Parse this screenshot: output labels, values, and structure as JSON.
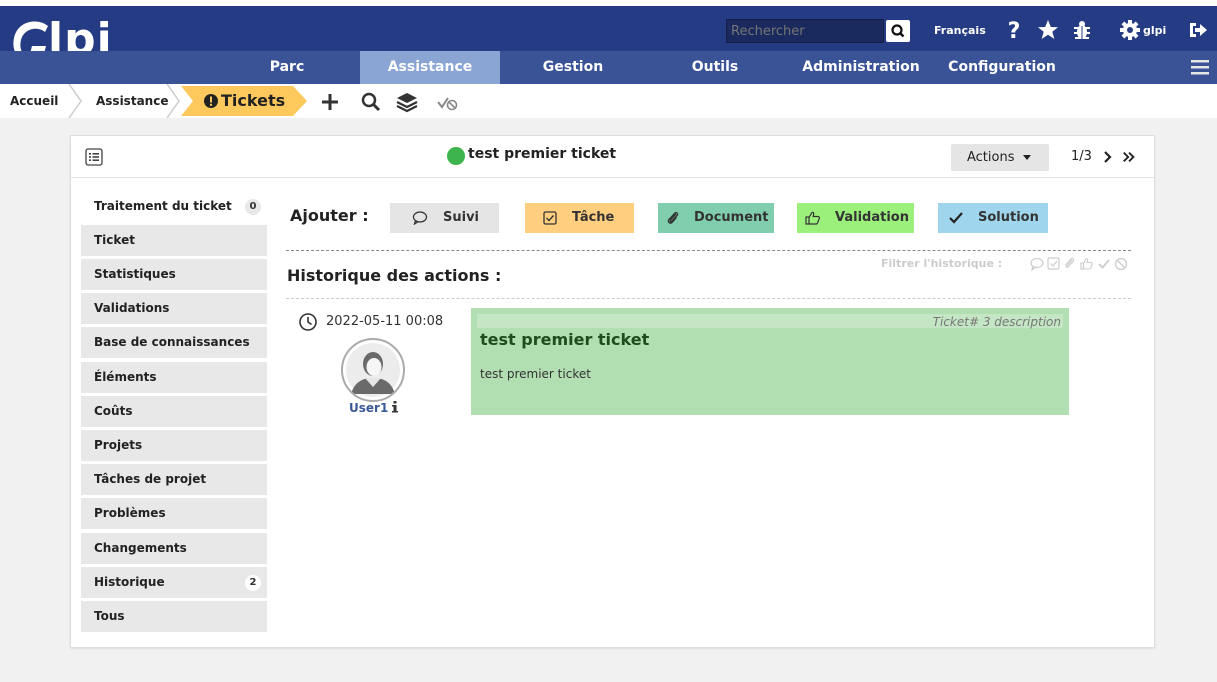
{
  "header": {
    "logo_text": "lpi",
    "search_placeholder": "Rechercher",
    "language": "Français",
    "user": "glpi",
    "menu": [
      {
        "label": "Parc"
      },
      {
        "label": "Assistance"
      },
      {
        "label": "Gestion"
      },
      {
        "label": "Outils"
      },
      {
        "label": "Administration"
      },
      {
        "label": "Configuration"
      }
    ]
  },
  "breadcrumb": {
    "home": "Accueil",
    "section": "Assistance",
    "current": "Tickets"
  },
  "ticket": {
    "title": "test premier ticket",
    "actions_label": "Actions",
    "pager": "1/3"
  },
  "tabs": [
    {
      "label": "Traitement du ticket",
      "count": "0"
    },
    {
      "label": "Ticket"
    },
    {
      "label": "Statistiques"
    },
    {
      "label": "Validations"
    },
    {
      "label": "Base de connaissances"
    },
    {
      "label": "Éléments"
    },
    {
      "label": "Coûts"
    },
    {
      "label": "Projets"
    },
    {
      "label": "Tâches de projet"
    },
    {
      "label": "Problèmes"
    },
    {
      "label": "Changements"
    },
    {
      "label": "Historique",
      "count": "2"
    },
    {
      "label": "Tous"
    }
  ],
  "add": {
    "label": "Ajouter :",
    "buttons": [
      {
        "label": "Suivi",
        "color": "#e5e5e5"
      },
      {
        "label": "Tâche",
        "color": "#ffcf7f"
      },
      {
        "label": "Document",
        "color": "#80cead"
      },
      {
        "label": "Validation",
        "color": "#9bef7b"
      },
      {
        "label": "Solution",
        "color": "#9fd6ed"
      }
    ]
  },
  "history": {
    "title": "Historique des actions :",
    "filter_label": "Filtrer l'historique :",
    "item": {
      "date": "2022-05-11 00:08",
      "user": "User1",
      "meta": "Ticket# 3 description",
      "title": "test premier ticket",
      "content": "test premier ticket"
    }
  }
}
